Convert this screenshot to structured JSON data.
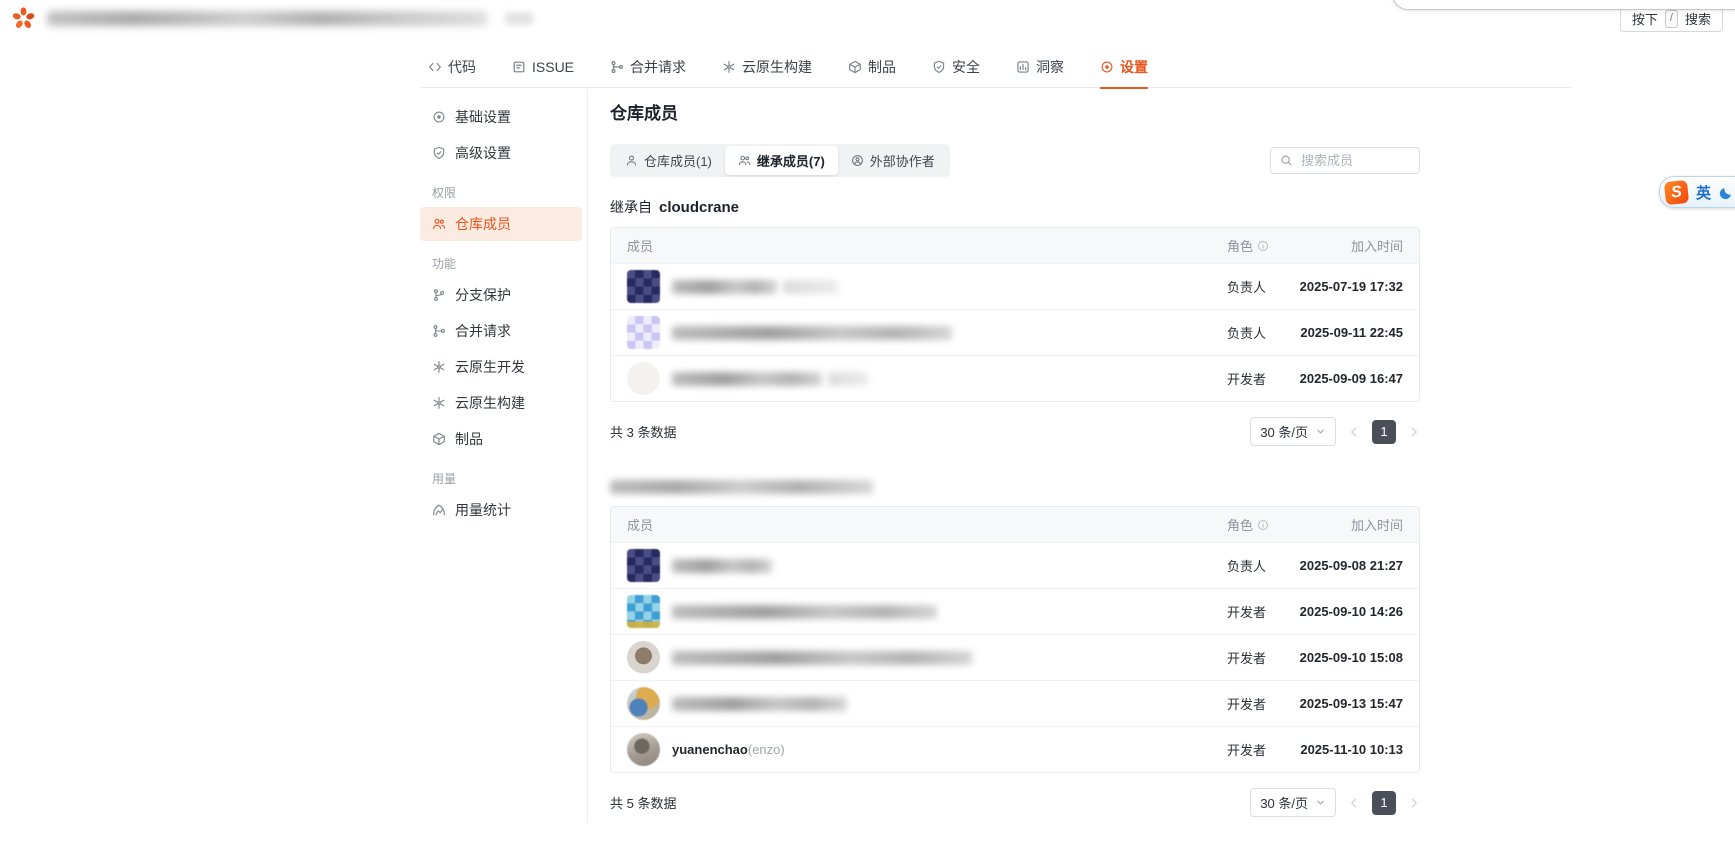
{
  "colors": {
    "accent": "#e8541e",
    "active_page_bg": "#4a4f5a",
    "sidebar_active_bg": "#fcebe0"
  },
  "topbar": {
    "search_hint": {
      "press": "按下",
      "key": "/",
      "search": "搜索"
    }
  },
  "repo_nav": {
    "tabs": [
      {
        "label": "代码"
      },
      {
        "label": "ISSUE"
      },
      {
        "label": "合并请求"
      },
      {
        "label": "云原生构建"
      },
      {
        "label": "制品"
      },
      {
        "label": "安全"
      },
      {
        "label": "洞察"
      },
      {
        "label": "设置"
      }
    ]
  },
  "sidebar": {
    "items_top": [
      {
        "label": "基础设置"
      },
      {
        "label": "高级设置"
      }
    ],
    "section_permission": "权限",
    "item_members": "仓库成员",
    "section_features": "功能",
    "features": [
      "分支保护",
      "合并请求",
      "云原生开发",
      "云原生构建",
      "制品"
    ],
    "section_usage": "用量",
    "item_usage_stats": "用量统计"
  },
  "main": {
    "title": "仓库成员",
    "member_tabs": [
      {
        "label": "仓库成员(1)"
      },
      {
        "label": "继承成员(7)"
      },
      {
        "label": "外部协作者"
      }
    ],
    "search_placeholder": "搜索成员",
    "sections": [
      {
        "title_prefix": "继承自",
        "title_name": "cloudcrane",
        "columns": {
          "member": "成员",
          "role": "角色",
          "joined": "加入时间"
        },
        "rows": [
          {
            "name_redacted": true,
            "role": "负责人",
            "joined": "2025-07-19 17:32"
          },
          {
            "name_redacted": true,
            "role": "负责人",
            "joined": "2025-09-11 22:45"
          },
          {
            "name_redacted": true,
            "role": "开发者",
            "joined": "2025-09-09 16:47"
          }
        ],
        "footer": {
          "total": "共 3 条数据",
          "page_size": "30 条/页",
          "page": "1"
        }
      },
      {
        "title_redacted": true,
        "columns": {
          "member": "成员",
          "role": "角色",
          "joined": "加入时间"
        },
        "rows": [
          {
            "name_redacted": true,
            "role": "负责人",
            "joined": "2025-09-08 21:27"
          },
          {
            "name_redacted": true,
            "role": "开发者",
            "joined": "2025-09-10 14:26"
          },
          {
            "name_redacted": true,
            "role": "开发者",
            "joined": "2025-09-10 15:08"
          },
          {
            "name_redacted": true,
            "role": "开发者",
            "joined": "2025-09-13 15:47"
          },
          {
            "name": "yuanenchao",
            "name_suffix": "(enzo)",
            "role": "开发者",
            "joined": "2025-11-10 10:13"
          }
        ],
        "footer": {
          "total": "共 5 条数据",
          "page_size": "30 条/页",
          "page": "1"
        }
      }
    ]
  },
  "ime": {
    "lang": "英"
  }
}
